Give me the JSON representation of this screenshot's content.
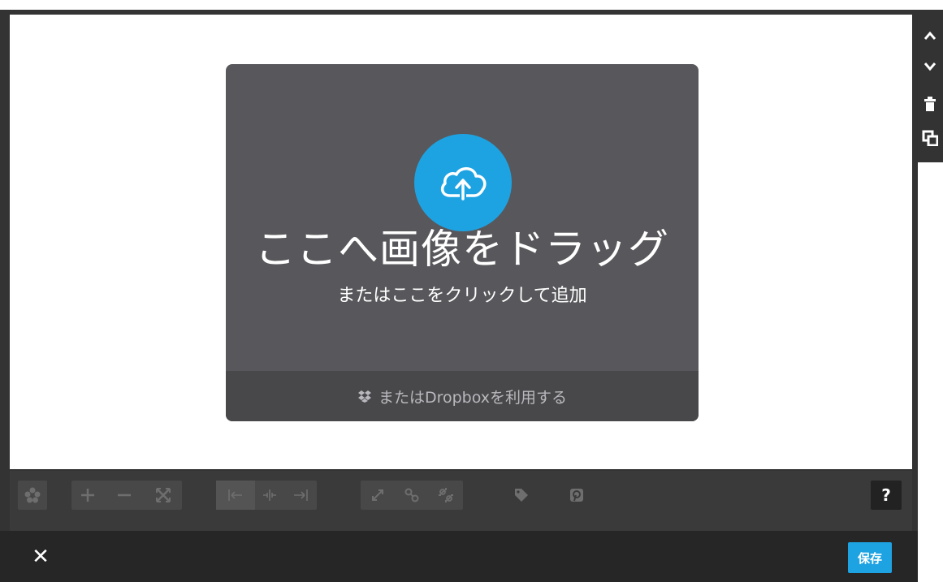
{
  "dropzone": {
    "title": "ここへ画像をドラッグ",
    "subtitle": "またはここをクリックして追加",
    "dropbox_label": "またはDropboxを利用する"
  },
  "side_tools": {
    "icons": [
      "chevron-up-icon",
      "chevron-down-icon",
      "trash-icon",
      "duplicate-icon"
    ]
  },
  "toolbar": {
    "groups": [
      [
        "filter-icon"
      ],
      [
        "zoom-in-icon",
        "zoom-out-icon",
        "fit-icon"
      ],
      [
        "align-left-icon",
        "align-center-icon",
        "align-right-icon"
      ],
      [
        "resize-icon",
        "link-icon",
        "unlink-icon"
      ],
      [
        "tag-icon"
      ],
      [
        "pinterest-icon"
      ]
    ],
    "help_label": "?"
  },
  "bottom_bar": {
    "close_label": "✕",
    "save_label": "保存"
  },
  "colors": {
    "accent": "#1ea3e2",
    "dropzone_bg": "#58585c",
    "toolbar_bg": "#3a3a3a",
    "bottom_bg": "#262626"
  }
}
